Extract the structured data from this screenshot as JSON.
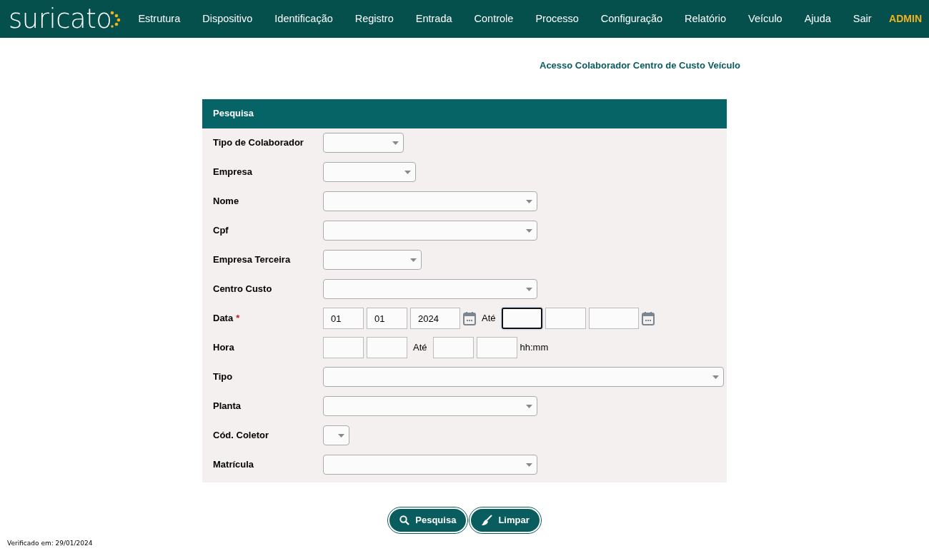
{
  "navbar": {
    "logo": "suricato",
    "menu": [
      {
        "label": "Estrutura"
      },
      {
        "label": "Dispositivo"
      },
      {
        "label": "Identificação"
      },
      {
        "label": "Registro"
      },
      {
        "label": "Entrada"
      },
      {
        "label": "Controle"
      },
      {
        "label": "Processo"
      },
      {
        "label": "Configuração"
      },
      {
        "label": "Relatório"
      },
      {
        "label": "Veículo"
      },
      {
        "label": "Ajuda"
      },
      {
        "label": "Sair"
      }
    ],
    "user": "ADMIN"
  },
  "page_title": "Acesso Colaborador Centro de Custo Veículo",
  "panel": {
    "title": "Pesquisa",
    "rows": [
      {
        "kind": "select",
        "label": "Tipo de Colaborador"
      },
      {
        "kind": "select",
        "label": "Empresa"
      },
      {
        "kind": "select",
        "label": "Nome"
      },
      {
        "kind": "select",
        "label": "Cpf"
      },
      {
        "kind": "select",
        "label": "Empresa Terceira"
      },
      {
        "kind": "select",
        "label": "Centro Custo"
      },
      {
        "kind": "date",
        "label": "Data",
        "required_mark": "*",
        "separator": "Até",
        "fields": [
          {
            "value": "01",
            "focused": false
          },
          {
            "value": "01",
            "focused": false
          },
          {
            "value": "2024",
            "focused": false
          },
          {
            "focused": true
          },
          {
            "focused": false
          },
          {
            "focused": false
          }
        ]
      },
      {
        "kind": "time",
        "label": "Hora",
        "separator": "Até",
        "suffix": "hh:mm",
        "fields": [
          {
            "focused": false
          },
          {
            "focused": false
          },
          {
            "focused": false
          },
          {
            "focused": false
          }
        ]
      },
      {
        "kind": "select",
        "label": "Tipo"
      },
      {
        "kind": "select",
        "label": "Planta"
      },
      {
        "kind": "select",
        "label": "Cód. Coletor"
      },
      {
        "kind": "select",
        "label": "Matrícula"
      }
    ]
  },
  "buttons": [
    {
      "kind": "search",
      "label": "Pesquisa"
    },
    {
      "kind": "clear",
      "label": "Limpar"
    }
  ],
  "footer": "Verificado em: 29/01/2024"
}
